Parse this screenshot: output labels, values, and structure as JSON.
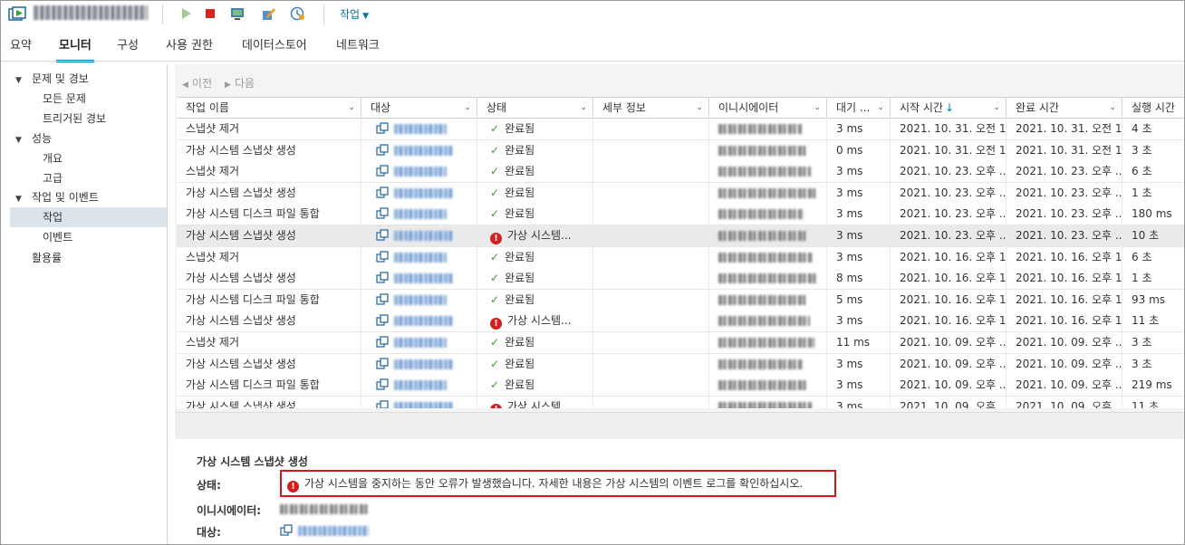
{
  "toolbar": {
    "actions_label": "작업"
  },
  "tabs": [
    "요약",
    "모니터",
    "구성",
    "사용 권한",
    "데이터스토어",
    "네트워크"
  ],
  "sidebar": {
    "group1": {
      "label": "문제 및 경보",
      "items": [
        "모든 문제",
        "트리거된 경보"
      ]
    },
    "group2": {
      "label": "성능",
      "items": [
        "개요",
        "고급"
      ]
    },
    "group3": {
      "label": "작업 및 이벤트",
      "items": [
        "작업",
        "이벤트"
      ]
    },
    "last": "활용률"
  },
  "pager": {
    "prev": "이전",
    "next": "다음"
  },
  "columns": {
    "name": "작업 이름",
    "target": "대상",
    "status": "상태",
    "details": "세부 정보",
    "initiator": "이니시에이터",
    "queued": "대기 ...",
    "start": "시작 시간",
    "end": "완료 시간",
    "exec": "실행 시간"
  },
  "rows": [
    {
      "name": "스냅샷 제거",
      "status": "완료됨",
      "error": false,
      "queued": "3 ms",
      "start": "2021. 10. 31. 오전 1...",
      "end": "2021. 10. 31. 오전 1...",
      "exec": "4 초"
    },
    {
      "name": "가상 시스템 스냅샷 생성",
      "status": "완료됨",
      "error": false,
      "queued": "0 ms",
      "start": "2021. 10. 31. 오전 1...",
      "end": "2021. 10. 31. 오전 1...",
      "exec": "3 초"
    },
    {
      "name": "스냅샷 제거",
      "status": "완료됨",
      "error": false,
      "queued": "3 ms",
      "start": "2021. 10. 23. 오후 ...",
      "end": "2021. 10. 23. 오후 ...",
      "exec": "6 초"
    },
    {
      "name": "가상 시스템 스냅샷 생성",
      "status": "완료됨",
      "error": false,
      "queued": "3 ms",
      "start": "2021. 10. 23. 오후 ...",
      "end": "2021. 10. 23. 오후 ...",
      "exec": "1 초"
    },
    {
      "name": "가상 시스템 디스크 파일 통합",
      "status": "완료됨",
      "error": false,
      "queued": "3 ms",
      "start": "2021. 10. 23. 오후 ...",
      "end": "2021. 10. 23. 오후 ...",
      "exec": "180 ms"
    },
    {
      "name": "가상 시스템 스냅샷 생성",
      "status": "가상 시스템...",
      "error": true,
      "queued": "3 ms",
      "start": "2021. 10. 23. 오후 ...",
      "end": "2021. 10. 23. 오후 ...",
      "exec": "10 초"
    },
    {
      "name": "스냅샷 제거",
      "status": "완료됨",
      "error": false,
      "queued": "3 ms",
      "start": "2021. 10. 16. 오후 1...",
      "end": "2021. 10. 16. 오후 1...",
      "exec": "6 초"
    },
    {
      "name": "가상 시스템 스냅샷 생성",
      "status": "완료됨",
      "error": false,
      "queued": "8 ms",
      "start": "2021. 10. 16. 오후 1...",
      "end": "2021. 10. 16. 오후 1...",
      "exec": "1 초"
    },
    {
      "name": "가상 시스템 디스크 파일 통합",
      "status": "완료됨",
      "error": false,
      "queued": "5 ms",
      "start": "2021. 10. 16. 오후 1...",
      "end": "2021. 10. 16. 오후 1...",
      "exec": "93 ms"
    },
    {
      "name": "가상 시스템 스냅샷 생성",
      "status": "가상 시스템...",
      "error": true,
      "queued": "3 ms",
      "start": "2021. 10. 16. 오후 1...",
      "end": "2021. 10. 16. 오후 1...",
      "exec": "11 초"
    },
    {
      "name": "스냅샷 제거",
      "status": "완료됨",
      "error": false,
      "queued": "11 ms",
      "start": "2021. 10. 09. 오후 ...",
      "end": "2021. 10. 09. 오후 ...",
      "exec": "3 초"
    },
    {
      "name": "가상 시스템 스냅샷 생성",
      "status": "완료됨",
      "error": false,
      "queued": "3 ms",
      "start": "2021. 10. 09. 오후 ...",
      "end": "2021. 10. 09. 오후 ...",
      "exec": "3 초"
    },
    {
      "name": "가상 시스템 디스크 파일 통합",
      "status": "완료됨",
      "error": false,
      "queued": "3 ms",
      "start": "2021. 10. 09. 오후 ...",
      "end": "2021. 10. 09. 오후 ...",
      "exec": "219 ms"
    },
    {
      "name": "가상 시스템 스냅샷 생성",
      "status": "가상 시스템...",
      "error": true,
      "queued": "3 ms",
      "start": "2021. 10. 09. 오후 ...",
      "end": "2021. 10. 09. 오후 ...",
      "exec": "11 초"
    }
  ],
  "details": {
    "title": "가상 시스템 스냅샷 생성",
    "status_label": "상태:",
    "status_message": "가상 시스템을 중지하는 동안 오류가 발생했습니다. 자세한 내용은 가상 시스템의 이벤트 로그를 확인하십시오.",
    "initiator_label": "이니시에이터:",
    "target_label": "대상:"
  },
  "colors": {
    "accent": "#0079b8",
    "error": "#d11f1f",
    "success": "#3a9c2e"
  }
}
